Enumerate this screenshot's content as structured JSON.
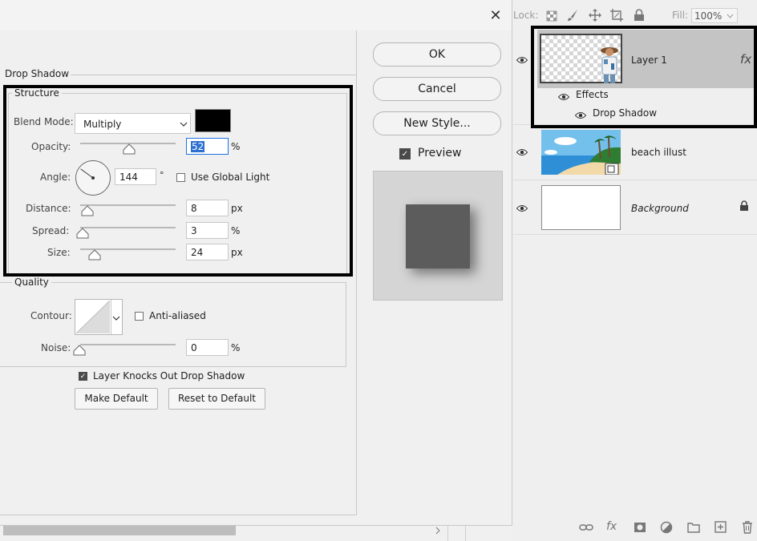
{
  "dialog": {
    "close_glyph": "✕",
    "section_title": "Drop Shadow",
    "structure": {
      "legend": "Structure",
      "blend_mode_label": "Blend Mode:",
      "blend_mode_value": "Multiply",
      "shadow_color": "#000000",
      "opacity_label": "Opacity:",
      "opacity_value": "52",
      "opacity_unit": "%",
      "opacity_level": 52,
      "angle_label": "Angle:",
      "angle_value": "144",
      "angle_unit": "°",
      "use_global_light_label": "Use Global Light",
      "use_global_light_checked": false,
      "distance_label": "Distance:",
      "distance_value": "8",
      "distance_unit": "px",
      "spread_label": "Spread:",
      "spread_value": "3",
      "spread_unit": "%",
      "size_label": "Size:",
      "size_value": "24",
      "size_unit": "px"
    },
    "quality": {
      "legend": "Quality",
      "contour_label": "Contour:",
      "anti_aliased_label": "Anti-aliased",
      "anti_aliased_checked": false,
      "noise_label": "Noise:",
      "noise_value": "0",
      "noise_unit": "%"
    },
    "knocks_out_label": "Layer Knocks Out Drop Shadow",
    "knocks_out_checked": true,
    "make_default_label": "Make Default",
    "reset_default_label": "Reset to Default",
    "ok_label": "OK",
    "cancel_label": "Cancel",
    "new_style_label": "New Style...",
    "preview_label": "Preview",
    "preview_checked": true
  },
  "layers_panel": {
    "lock_label": "Lock:",
    "fill_label": "Fill:",
    "fill_value": "100%",
    "layers": [
      {
        "name": "Layer 1",
        "fx": "fx",
        "selected": true
      },
      {
        "name": "beach illust",
        "selected": false
      },
      {
        "name": "Background",
        "locked": true,
        "selected": false
      }
    ],
    "effects_label": "Effects",
    "drop_shadow_label": "Drop Shadow",
    "footer_fx": "fx"
  },
  "colors": {
    "selected_row": "#c4c4c4",
    "highlight_border": "#000000",
    "preview_square": "#5c5c5c"
  }
}
